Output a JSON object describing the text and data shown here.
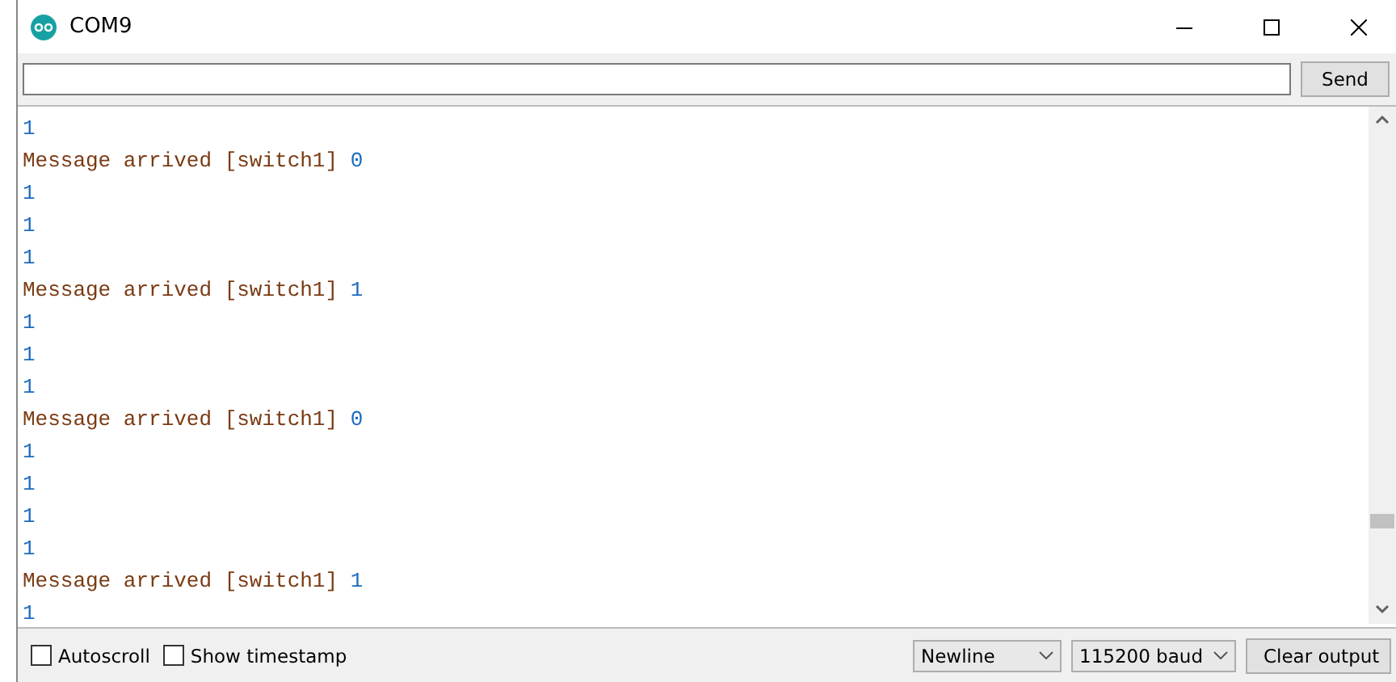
{
  "window": {
    "title": "COM9"
  },
  "input": {
    "button": "Send"
  },
  "output": [
    {
      "kind": "value",
      "value": "1"
    },
    {
      "kind": "message",
      "text": "Message arrived [switch1]",
      "value": "0"
    },
    {
      "kind": "value",
      "value": "1"
    },
    {
      "kind": "value",
      "value": "1"
    },
    {
      "kind": "value",
      "value": "1"
    },
    {
      "kind": "message",
      "text": "Message arrived [switch1]",
      "value": "1"
    },
    {
      "kind": "value",
      "value": "1"
    },
    {
      "kind": "value",
      "value": "1"
    },
    {
      "kind": "value",
      "value": "1"
    },
    {
      "kind": "message",
      "text": "Message arrived [switch1]",
      "value": "0"
    },
    {
      "kind": "value",
      "value": "1"
    },
    {
      "kind": "value",
      "value": "1"
    },
    {
      "kind": "value",
      "value": "1"
    },
    {
      "kind": "value",
      "value": "1"
    },
    {
      "kind": "message",
      "text": "Message arrived [switch1]",
      "value": "1"
    },
    {
      "kind": "value",
      "value": "1"
    }
  ],
  "options": [
    {
      "label": "Autoscroll",
      "checked": false
    },
    {
      "label": "Show timestamp",
      "checked": false
    }
  ],
  "line_ending": "Newline",
  "baud": "115200 baud",
  "clear_button": "Clear output"
}
